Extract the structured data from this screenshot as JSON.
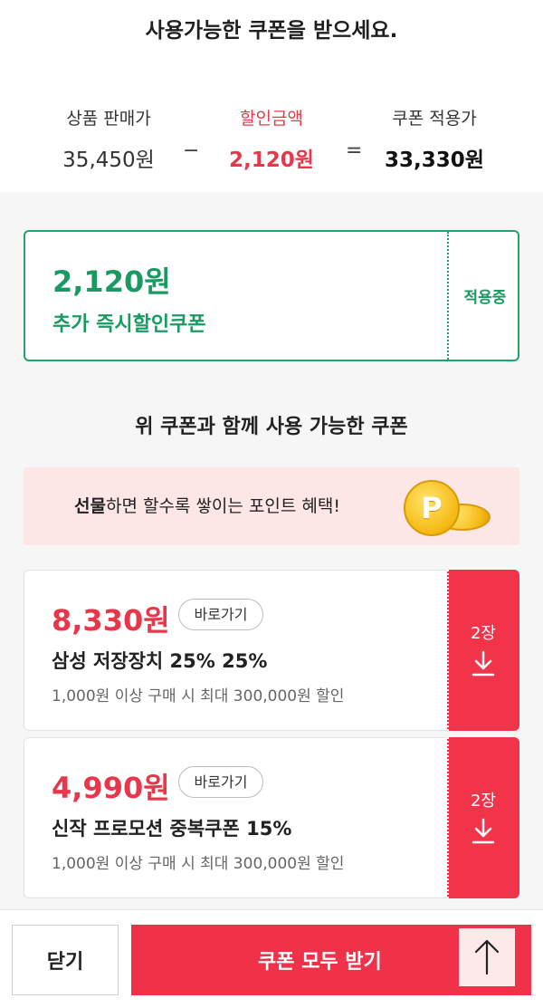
{
  "header": {
    "title": "사용가능한 쿠폰을 받으세요."
  },
  "summary": {
    "price_label": "상품 판매가",
    "price_value": "35,450원",
    "minus": "−",
    "discount_label": "할인금액",
    "discount_value": "2,120원",
    "equals": "=",
    "final_label": "쿠폰 적용가",
    "final_value": "33,330원"
  },
  "applied_coupon": {
    "amount": "2,120원",
    "name": "추가 즉시할인쿠폰",
    "status": "적용중"
  },
  "section_title": "위 쿠폰과 함께 사용 가능한 쿠폰",
  "promo": {
    "bold_text": "선물",
    "text": "하면 할수록 쌓이는 포인트 혜택!",
    "coin_letter": "P"
  },
  "coupons": [
    {
      "amount": "8,330원",
      "shortcut_label": "바로가기",
      "name": "삼성 저장장치 25% 25%",
      "condition": "1,000원 이상 구매 시 최대 300,000원 할인",
      "count": "2장",
      "icon": "download-icon"
    },
    {
      "amount": "4,990원",
      "shortcut_label": "바로가기",
      "name": "신작 프로모션 중복쿠폰 15%",
      "condition": "1,000원 이상 구매 시 최대 300,000원 할인",
      "count": "2장",
      "icon": "download-icon"
    }
  ],
  "footer": {
    "close_label": "닫기",
    "get_all_label": "쿠폰 모두 받기",
    "top_icon": "arrow-up-icon"
  },
  "colors": {
    "accent_red": "#ef3149",
    "accent_green": "#1a9a62",
    "promo_bg": "#fde6e6"
  }
}
